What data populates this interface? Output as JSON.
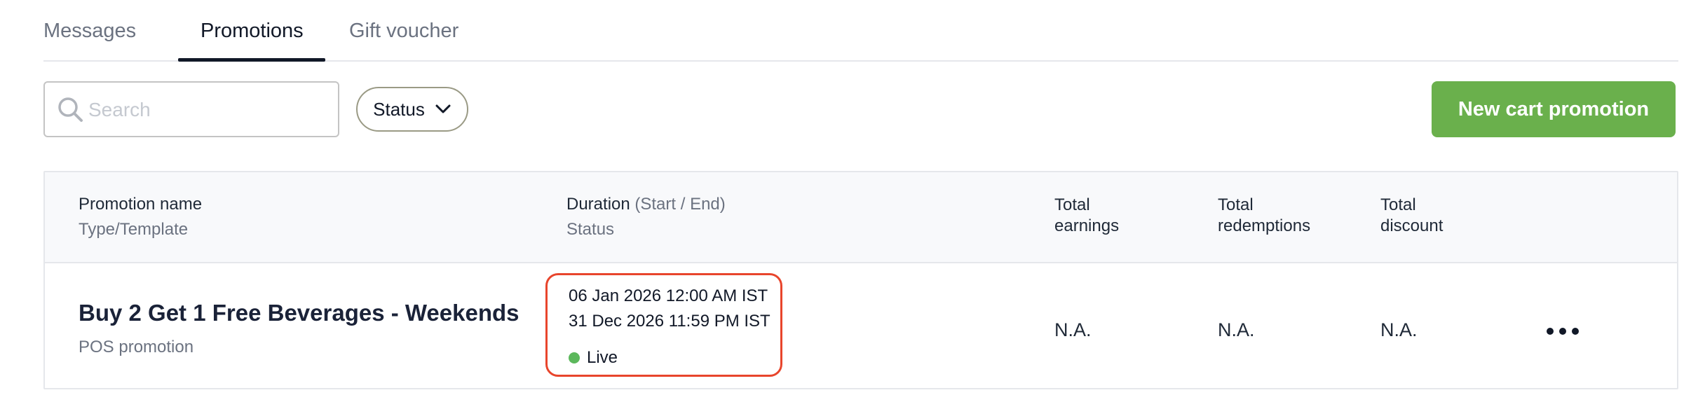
{
  "tabs": [
    {
      "label": "Messages",
      "active": false
    },
    {
      "label": "Promotions",
      "active": true
    },
    {
      "label": "Gift voucher",
      "active": false
    }
  ],
  "toolbar": {
    "search_placeholder": "Search",
    "search_value": "",
    "status_filter_label": "Status",
    "new_promotion_label": "New cart promotion"
  },
  "table": {
    "headers": {
      "promotion_name": "Promotion name",
      "type_template": "Type/Template",
      "duration": "Duration",
      "duration_hint": "(Start / End)",
      "status": "Status",
      "total_earnings_1": "Total",
      "total_earnings_2": "earnings",
      "total_redemptions_1": "Total",
      "total_redemptions_2": "redemptions",
      "total_discount_1": "Total",
      "total_discount_2": "discount"
    },
    "rows": [
      {
        "name": "Buy 2 Get 1 Free Beverages - Weekends",
        "type": "POS promotion",
        "start": "06 Jan 2026 12:00 AM IST",
        "end": "31 Dec 2026 11:59 PM IST",
        "status": "Live",
        "total_earnings": "N.A.",
        "total_redemptions": "N.A.",
        "total_discount": "N.A."
      }
    ]
  },
  "colors": {
    "accent_green": "#6ab04c",
    "live_status": "#5cb85c",
    "highlight_border": "#e8452c"
  },
  "icons": {
    "search": "search-icon",
    "status_dropdown": "chevron-down-icon",
    "row_actions": "more-horizontal-icon"
  }
}
